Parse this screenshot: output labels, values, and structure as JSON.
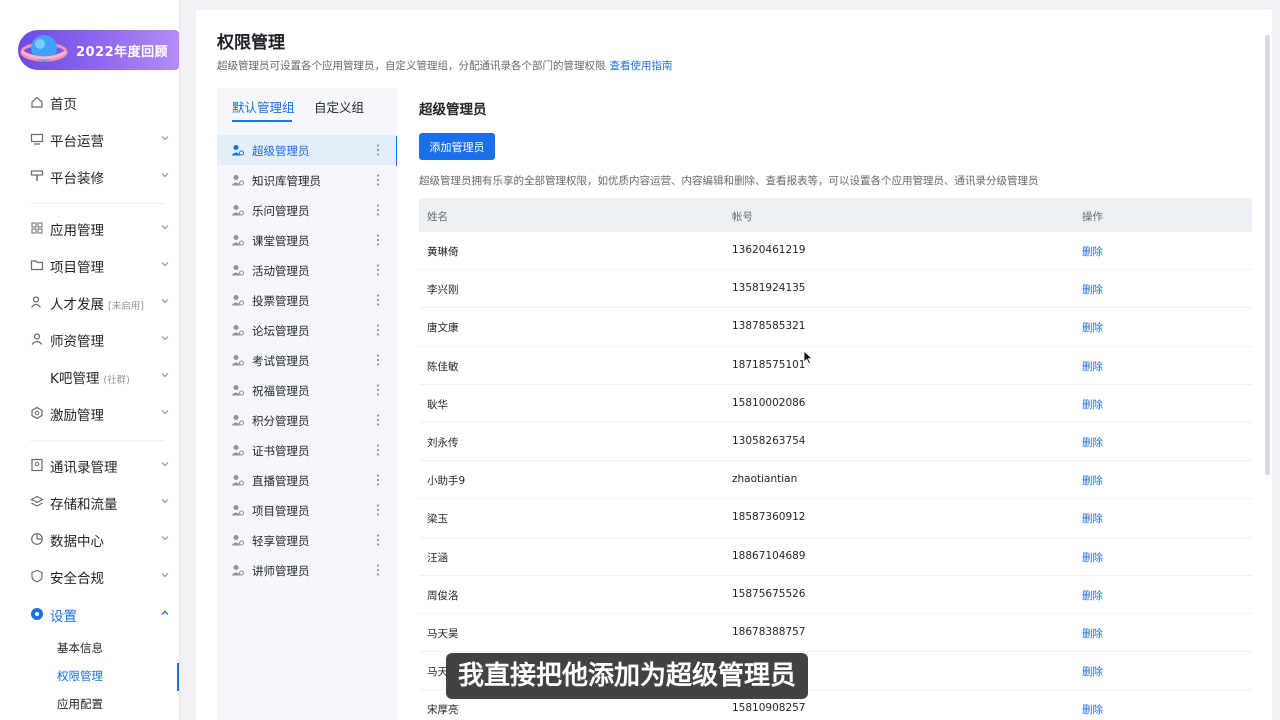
{
  "banner": {
    "text": "2022年度回顾"
  },
  "sidebar": {
    "items": [
      {
        "label": "首页",
        "icon": "home-icon"
      },
      {
        "label": "平台运营",
        "icon": "monitor-icon"
      },
      {
        "label": "平台装修",
        "icon": "brush-icon"
      },
      {
        "label": "应用管理",
        "icon": "grid-icon"
      },
      {
        "label": "项目管理",
        "icon": "folder-icon"
      },
      {
        "label": "人才发展",
        "tag": "[未启用]",
        "icon": "user-growth-icon"
      },
      {
        "label": "师资管理",
        "icon": "teacher-icon"
      },
      {
        "label": "K吧管理",
        "tag": "(社群)",
        "icon": "k-icon"
      },
      {
        "label": "激励管理",
        "icon": "medal-icon"
      },
      {
        "label": "通讯录管理",
        "icon": "contacts-icon"
      },
      {
        "label": "存储和流量",
        "icon": "storage-icon"
      },
      {
        "label": "数据中心",
        "icon": "pie-icon"
      },
      {
        "label": "安全合规",
        "icon": "shield-icon"
      },
      {
        "label": "设置",
        "icon": "settings-icon"
      }
    ],
    "sub_items": [
      {
        "label": "基本信息"
      },
      {
        "label": "权限管理"
      },
      {
        "label": "应用配置"
      }
    ]
  },
  "page": {
    "title": "权限管理",
    "desc": "超级管理员可设置各个应用管理员，自定义管理组，分配通讯录各个部门的管理权限",
    "guide_link": "查看使用指南"
  },
  "groups": {
    "tabs": [
      "默认管理组",
      "自定义组"
    ],
    "items": [
      "超级管理员",
      "知识库管理员",
      "乐问管理员",
      "课堂管理员",
      "活动管理员",
      "投票管理员",
      "论坛管理员",
      "考试管理员",
      "祝福管理员",
      "积分管理员",
      "证书管理员",
      "直播管理员",
      "项目管理员",
      "轻享管理员",
      "讲师管理员"
    ]
  },
  "content": {
    "title": "超级管理员",
    "add_button": "添加管理员",
    "desc": "超级管理员拥有乐享的全部管理权限，如优质内容运营、内容编辑和删除、查看报表等，可以设置各个应用管理员、通讯录分级管理员"
  },
  "table": {
    "headers": [
      "姓名",
      "帐号",
      "操作"
    ],
    "action_label": "删除",
    "rows": [
      {
        "name": "黄琳倚",
        "account": "13620461219"
      },
      {
        "name": "李兴刚",
        "account": "13581924135"
      },
      {
        "name": "唐文康",
        "account": "13878585321"
      },
      {
        "name": "陈佳敏",
        "account": "18718575101"
      },
      {
        "name": "耿华",
        "account": "15810002086"
      },
      {
        "name": "刘永传",
        "account": "13058263754"
      },
      {
        "name": "小助手9",
        "account": "zhaotiantian"
      },
      {
        "name": "梁玉",
        "account": "18587360912"
      },
      {
        "name": "汪涵",
        "account": "18867104689"
      },
      {
        "name": "周俊洛",
        "account": "15875675526"
      },
      {
        "name": "马天昊",
        "account": "18678388757"
      },
      {
        "name": "马天",
        "account": ""
      },
      {
        "name": "宋厚亮",
        "account": "15810908257"
      }
    ]
  },
  "subtitle": "我直接把他添加为超级管理员",
  "colors": {
    "accent": "#1b6fe8",
    "banner_start": "#6a4be0",
    "banner_end": "#b38cf5"
  }
}
